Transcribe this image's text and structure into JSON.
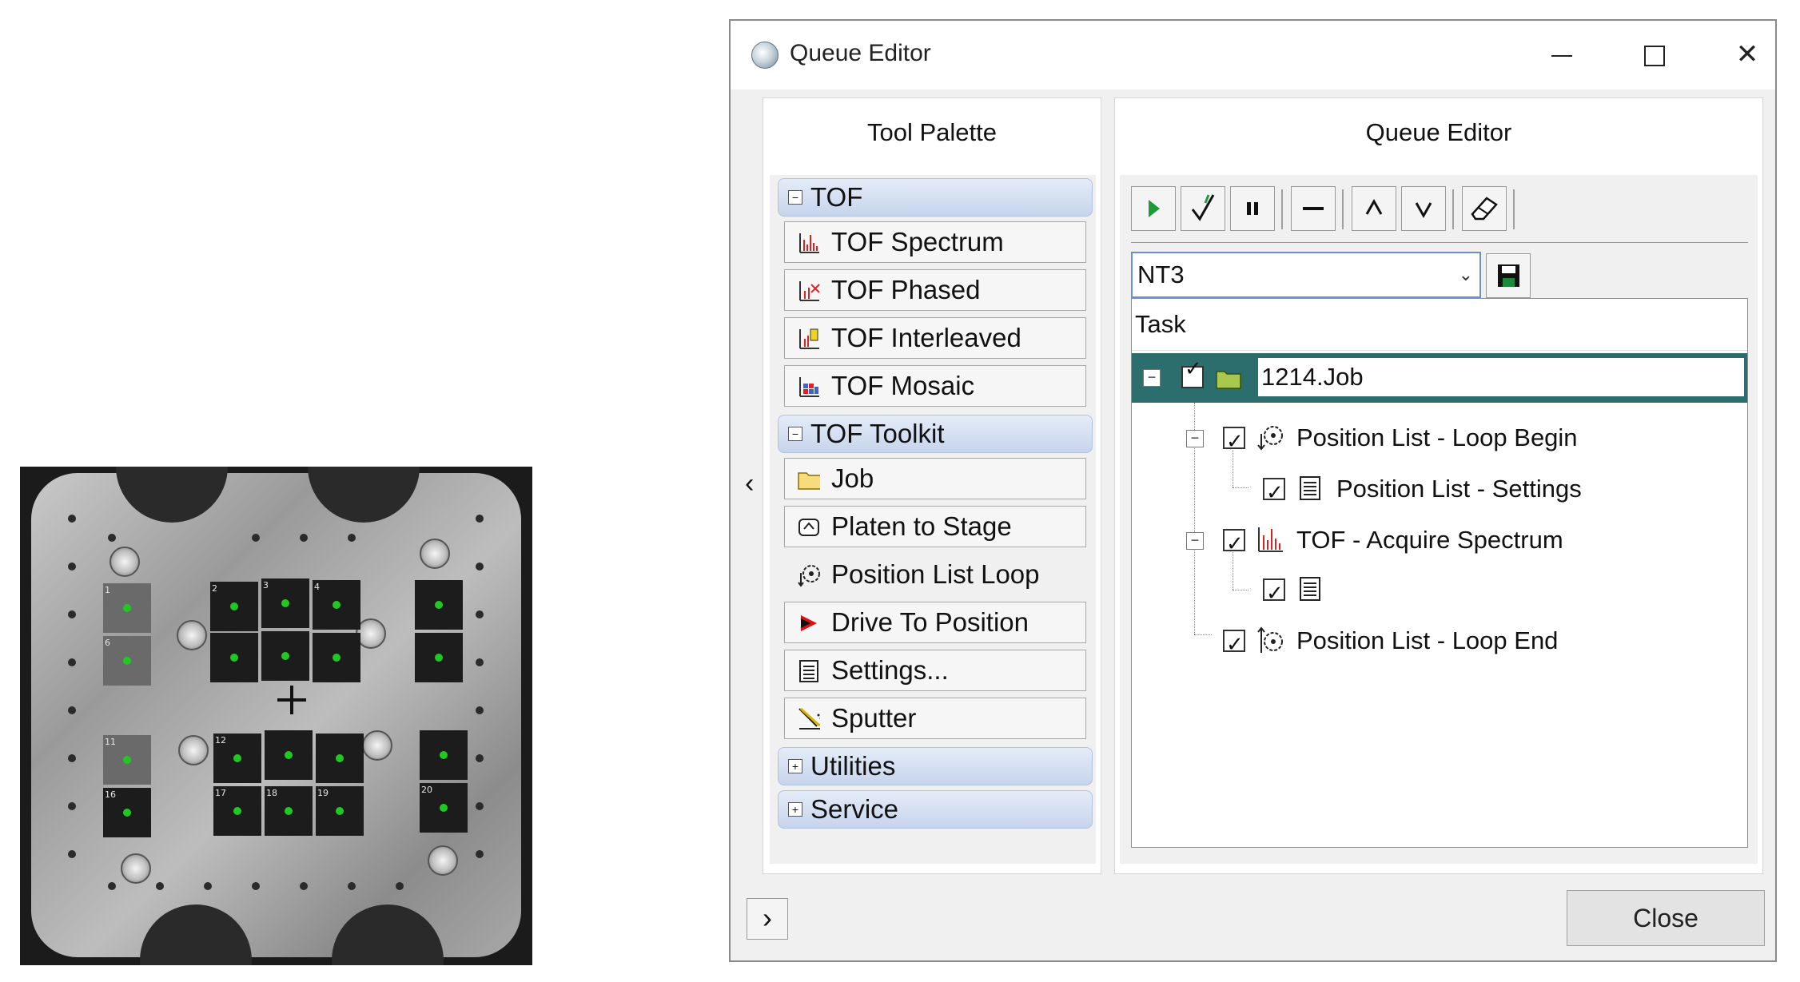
{
  "window": {
    "title": "Queue Editor",
    "close_button_label": "Close"
  },
  "tool_palette": {
    "header": "Tool Palette",
    "groups": [
      {
        "label": "TOF",
        "expanded": true,
        "items": [
          {
            "label": "TOF Spectrum",
            "icon": "spectrum-icon"
          },
          {
            "label": "TOF Phased",
            "icon": "phased-icon"
          },
          {
            "label": "TOF Interleaved",
            "icon": "interleaved-icon"
          },
          {
            "label": "TOF Mosaic",
            "icon": "mosaic-icon"
          }
        ]
      },
      {
        "label": "TOF Toolkit",
        "expanded": true,
        "items": [
          {
            "label": "Job",
            "icon": "folder-icon"
          },
          {
            "label": "Platen to Stage",
            "icon": "platen-icon"
          },
          {
            "label": "Position List Loop",
            "icon": "loop-icon"
          },
          {
            "label": "Drive To Position",
            "icon": "drive-icon"
          },
          {
            "label": "Settings...",
            "icon": "settings-list-icon"
          },
          {
            "label": "Sputter",
            "icon": "sputter-icon"
          }
        ]
      },
      {
        "label": "Utilities",
        "expanded": false
      },
      {
        "label": "Service",
        "expanded": false
      }
    ]
  },
  "queue_editor": {
    "header": "Queue Editor",
    "toolbar": [
      "play-icon",
      "check-icon",
      "pause-icon",
      "remove-icon",
      "move-up-icon",
      "move-down-icon",
      "eraser-icon"
    ],
    "queue_name": "NT3",
    "tree_header": "Task",
    "tree": [
      {
        "label": "1214.Job",
        "selected": true,
        "checked": true,
        "icon": "folder-icon"
      },
      {
        "label": "Position List - Loop Begin",
        "checked": true,
        "icon": "loop-begin-icon"
      },
      {
        "label": "Position List - Settings",
        "checked": true,
        "icon": "settings-list-icon"
      },
      {
        "label": "TOF - Acquire Spectrum",
        "checked": true,
        "icon": "spectrum-icon"
      },
      {
        "label": "",
        "checked": true,
        "icon": "settings-list-icon"
      },
      {
        "label": "Position List - Loop End",
        "checked": true,
        "icon": "loop-end-icon"
      }
    ]
  },
  "platen": {
    "sample_numbers": [
      "1",
      "2",
      "3",
      "4",
      "6",
      "11",
      "12",
      "16",
      "17",
      "18",
      "19",
      "20"
    ]
  }
}
